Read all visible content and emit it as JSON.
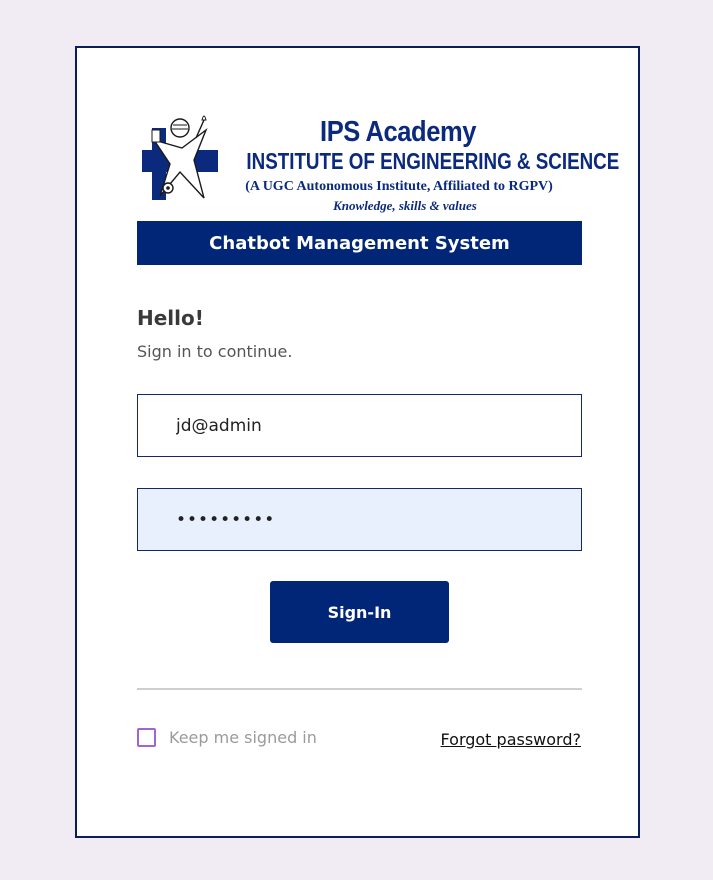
{
  "logo": {
    "icon": "ips-academy-emblem",
    "title": "IPS Academy",
    "subtitle": "INSTITUTE OF ENGINEERING & SCIENCE",
    "affiliation": "(A UGC Autonomous Institute, Affiliated to RGPV)",
    "tagline": "Knowledge, skills & values"
  },
  "banner": {
    "title": "Chatbot Management System"
  },
  "greeting": {
    "hello": "Hello!",
    "subtitle": "Sign in to continue."
  },
  "form": {
    "email_value": "jd@admin",
    "password_value": "passwordx"
  },
  "actions": {
    "signin_label": "Sign-In",
    "keep_signed_in_label": "Keep me signed in",
    "forgot_password_label": "Forgot password?"
  },
  "colors": {
    "brand": "#022677",
    "background": "#f1ecf3",
    "checkbox": "#a065d4",
    "password_fill": "#e8f0fe"
  }
}
